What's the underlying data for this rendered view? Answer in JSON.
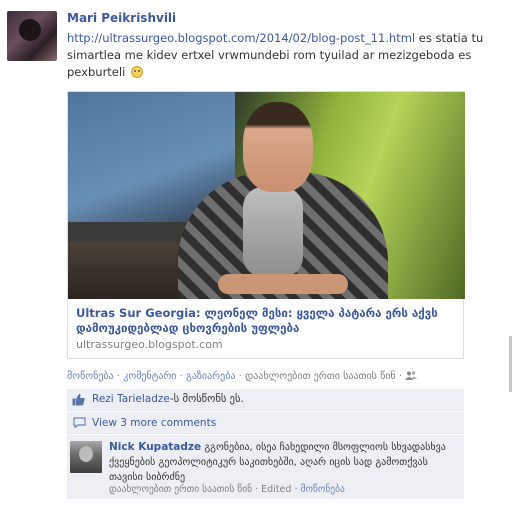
{
  "post": {
    "author": "Mari Peikrishvili",
    "url_text": "http://ultrassurgeo.blogspot.com/2014/02/blog-post_11.html",
    "message": " es statia tu simartlea me kidev ertxel vrwmundebi rom tyuilad ar mezizgeboda es pexburteli"
  },
  "link": {
    "title": "Ultras Sur Georgia: ლეონელ მესი: ყველა პატარა ერს აქვს დამოუკიდებლად ცხოვრების უფლება",
    "source": "ultrassurgeo.blogspot.com"
  },
  "actions": {
    "like": "მოწონება",
    "comment": "კომენტარი",
    "share": "გაზიარება",
    "time": "დაახლოებით ერთი საათის წინ",
    "sep": " · "
  },
  "likes": {
    "name": "Rezi Tarieladze",
    "suffix": "-ს მოსწონს ეს."
  },
  "view_comments": "View 3 more comments",
  "comment": {
    "author": "Nick Kupatadze",
    "text": "გგონებია, ისეა ჩახედილი მსოფლიოს სხვადასხვა ქვეყნების გეოპოლიტიკურ საკითხებში, აღარ იცის სად გამოთქვას თავისი სიბრძნე",
    "time": "დაახლოებით ერთი საათის წინ",
    "edited": "Edited",
    "like": "მოწონება"
  },
  "colors": {
    "link": "#3b5998",
    "muted": "#808080",
    "row_bg": "#edeff4"
  }
}
